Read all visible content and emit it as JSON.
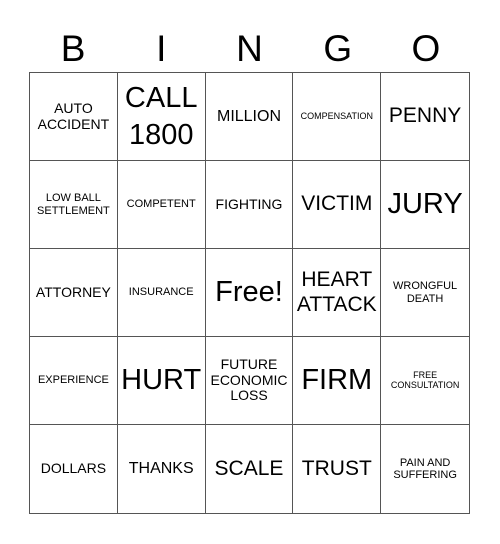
{
  "header": {
    "letters": [
      "B",
      "I",
      "N",
      "G",
      "O"
    ]
  },
  "cells": [
    {
      "text": "AUTO ACCIDENT",
      "size": "m"
    },
    {
      "text": "CALL 1800",
      "size": "xl"
    },
    {
      "text": "MILLION",
      "size": "md"
    },
    {
      "text": "COMPENSATION",
      "size": "xs"
    },
    {
      "text": "PENNY",
      "size": "l"
    },
    {
      "text": "LOW BALL SETTLEMENT",
      "size": "s"
    },
    {
      "text": "COMPETENT",
      "size": "s"
    },
    {
      "text": "FIGHTING",
      "size": "m"
    },
    {
      "text": "VICTIM",
      "size": "l"
    },
    {
      "text": "JURY",
      "size": "xl"
    },
    {
      "text": "ATTORNEY",
      "size": "m"
    },
    {
      "text": "INSURANCE",
      "size": "s"
    },
    {
      "text": "Free!",
      "size": "xl"
    },
    {
      "text": "HEART ATTACK",
      "size": "l"
    },
    {
      "text": "WRONGFUL DEATH",
      "size": "s"
    },
    {
      "text": "EXPERIENCE",
      "size": "s"
    },
    {
      "text": "HURT",
      "size": "xl"
    },
    {
      "text": "FUTURE ECONOMIC LOSS",
      "size": "m"
    },
    {
      "text": "FIRM",
      "size": "xl"
    },
    {
      "text": "FREE CONSULTATION",
      "size": "xs"
    },
    {
      "text": "DOLLARS",
      "size": "m"
    },
    {
      "text": "THANKS",
      "size": "md"
    },
    {
      "text": "SCALE",
      "size": "l"
    },
    {
      "text": "TRUST",
      "size": "l"
    },
    {
      "text": "PAIN AND SUFFERING",
      "size": "s"
    }
  ]
}
